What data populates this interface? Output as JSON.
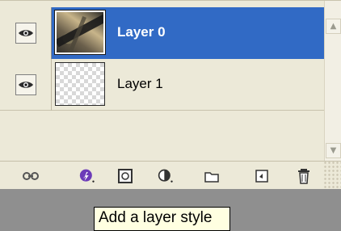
{
  "layers": [
    {
      "name": "Layer 0",
      "selected": true,
      "visible": true,
      "thumbnail": "photo"
    },
    {
      "name": "Layer 1",
      "selected": false,
      "visible": true,
      "thumbnail": "transparent"
    }
  ],
  "toolbar": {
    "icons": [
      "link-layers-icon",
      "add-layer-style-icon",
      "add-layer-mask-icon",
      "adjustment-layer-icon",
      "new-group-icon",
      "new-layer-icon",
      "delete-layer-icon"
    ]
  },
  "tooltip": {
    "text": "Add a layer style"
  },
  "colors": {
    "panel_background": "#ece9d8",
    "selection": "#316ac5",
    "tooltip_background": "#ffffe1",
    "lower_background": "#8f8f8f"
  }
}
